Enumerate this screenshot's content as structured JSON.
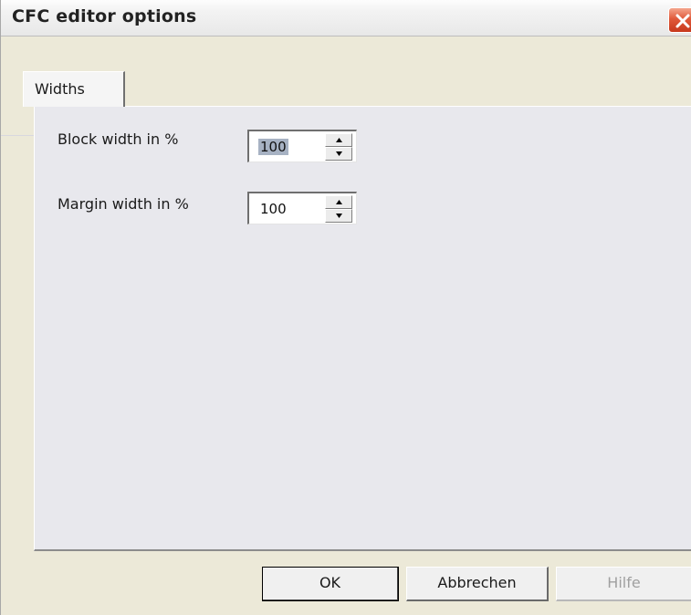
{
  "window": {
    "title": "CFC editor options"
  },
  "tabs": [
    {
      "label": "Widths",
      "selected": true
    }
  ],
  "fields": [
    {
      "label": "Block width in %",
      "value": "100",
      "selected_text": true
    },
    {
      "label": "Margin width in %",
      "value": "100",
      "selected_text": false
    }
  ],
  "buttons": {
    "ok": "OK",
    "cancel": "Abbrechen",
    "help": "Hilfe"
  },
  "icons": {
    "close": "close-x-icon",
    "spin_up": "triangle-up-icon",
    "spin_down": "triangle-down-icon"
  },
  "colors": {
    "dialog_background": "#ece9d8",
    "panel_background": "#e8e8ed",
    "close_button": "#d8482a",
    "selection_highlight": "#a7b2c3",
    "disabled_text": "#a0a0a0"
  }
}
